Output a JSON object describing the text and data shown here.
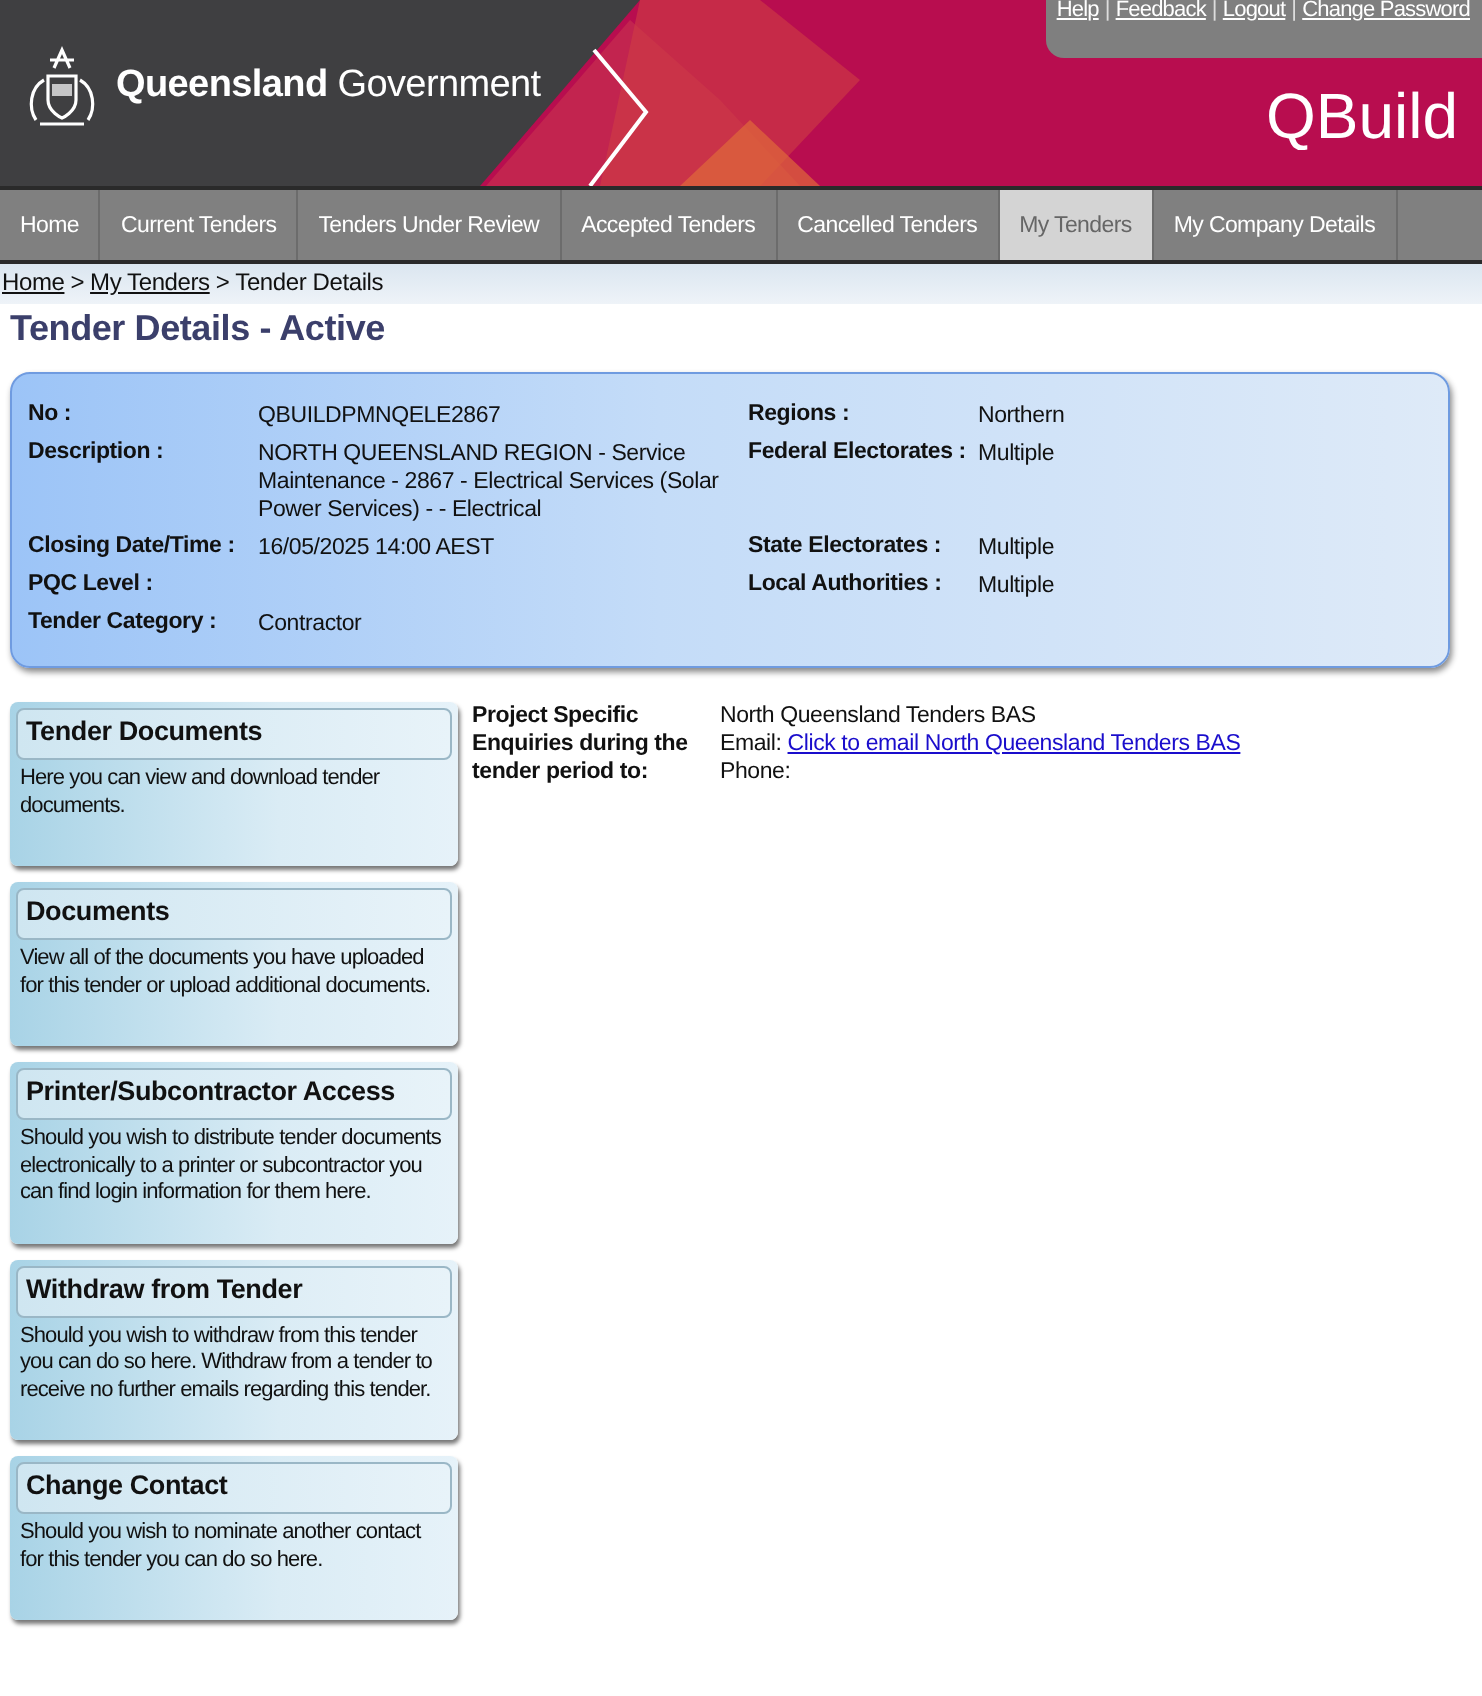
{
  "header": {
    "links": [
      "Help",
      "Feedback",
      "Logout",
      "Change Password"
    ],
    "separator": "|",
    "logo_bold": "Queensland",
    "logo_light": "Government",
    "app_title": "QBuild"
  },
  "nav": [
    {
      "label": "Home",
      "selected": false
    },
    {
      "label": "Current Tenders",
      "selected": false
    },
    {
      "label": "Tenders Under Review",
      "selected": false
    },
    {
      "label": "Accepted Tenders",
      "selected": false
    },
    {
      "label": "Cancelled Tenders",
      "selected": false
    },
    {
      "label": "My Tenders",
      "selected": true
    },
    {
      "label": "My Company Details",
      "selected": false
    }
  ],
  "breadcrumb": {
    "separator": ">",
    "items": [
      {
        "label": "Home",
        "link": true
      },
      {
        "label": "My Tenders",
        "link": true
      },
      {
        "label": "Tender Details",
        "link": false
      }
    ]
  },
  "title": "Tender Details - Active",
  "details": [
    {
      "label": "No :",
      "value": "QBUILDPMNQELE2867",
      "right_label": "Regions :",
      "right_value": "Northern"
    },
    {
      "label": "Description :",
      "value": "NORTH QUEENSLAND REGION - Service Maintenance - 2867 - Electrical Services (Solar Power Services) - - Electrical",
      "right_label": "Federal Electorates :",
      "right_value": "Multiple"
    },
    {
      "label": "Closing Date/Time :",
      "value": "16/05/2025 14:00 AEST",
      "right_label": "State Electorates :",
      "right_value": "Multiple"
    },
    {
      "label": "PQC Level :",
      "right_label": "Local Authorities :",
      "right_value": "Multiple"
    },
    {
      "label": "Tender Category :",
      "value": "Contractor"
    }
  ],
  "panels": [
    {
      "title": "Tender Documents",
      "text": "Here you can view and download tender documents."
    },
    {
      "title": "Documents",
      "text": "View all of the documents you have uploaded for this tender or upload additional documents."
    },
    {
      "title": "Printer/Subcontractor Access",
      "text": "Should you wish to distribute tender documents electronically to a printer or subcontractor you can find login information for them here."
    },
    {
      "title": "Withdraw from Tender",
      "text": "Should you wish to withdraw from this tender you can do so here. Withdraw from a tender to receive no further emails regarding this tender."
    },
    {
      "title": "Change Contact",
      "text": "Should you wish to nominate another contact for this tender you can do so here."
    }
  ],
  "contact": {
    "label": "Project Specific Enquiries during the tender period to:",
    "name": "North Queensland Tenders BAS",
    "email_label": "Email:",
    "email_link": "Click to email North Queensland Tenders BAS",
    "phone_label": "Phone:"
  }
}
